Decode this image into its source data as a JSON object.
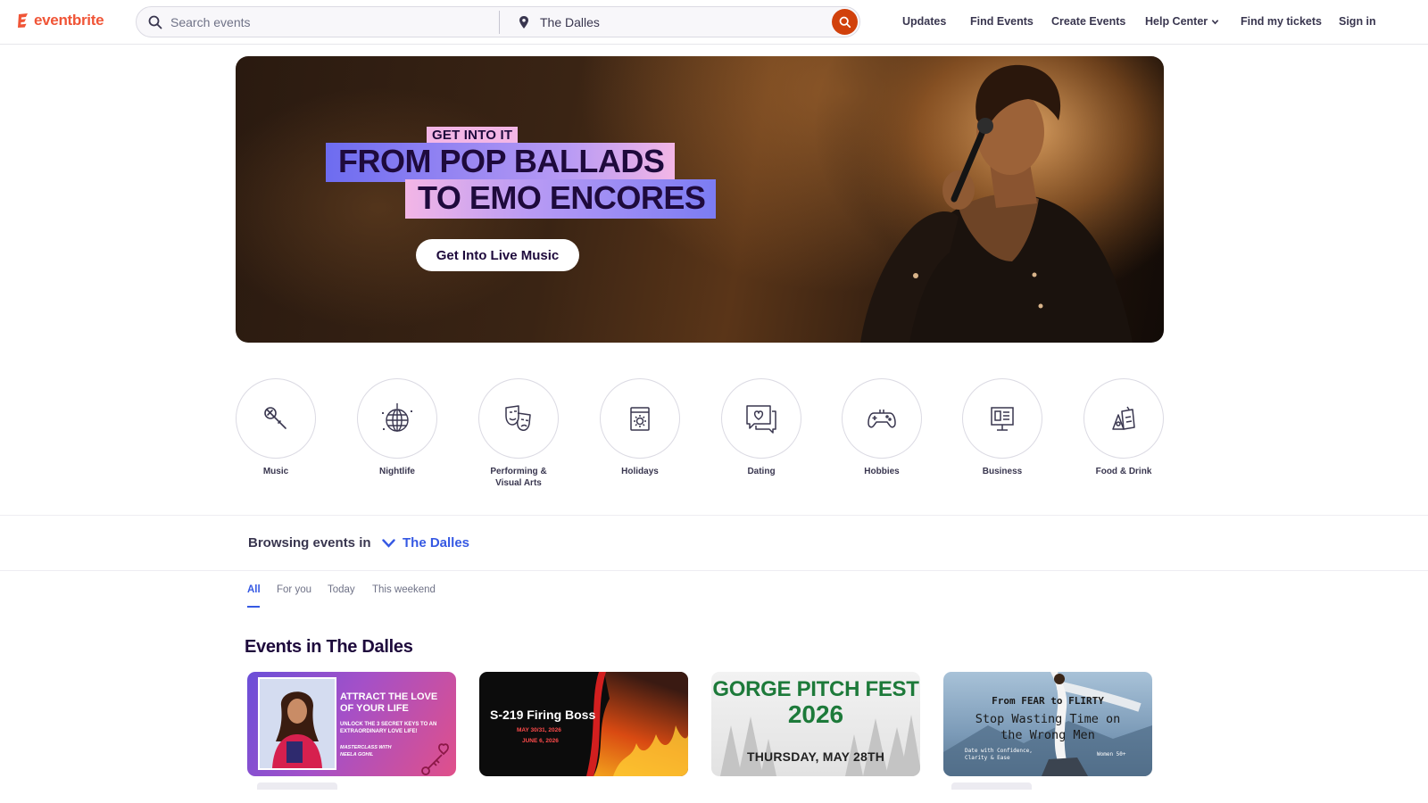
{
  "header": {
    "logo_text": "eventbrite",
    "search_placeholder": "Search events",
    "location_value": "The Dalles",
    "nav": [
      "Updates",
      "Find Events",
      "Create Events",
      "Help Center",
      "Find my tickets",
      "Sign in"
    ]
  },
  "hero": {
    "kicker": "GET INTO IT",
    "line1": "FROM POP BALLADS",
    "line2": "TO EMO ENCORES",
    "cta": "Get Into Live Music"
  },
  "categories": [
    {
      "label": "Music",
      "icon": "microphone-icon"
    },
    {
      "label": "Nightlife",
      "icon": "disco-ball-icon"
    },
    {
      "label": "Performing & Visual Arts",
      "icon": "theater-masks-icon"
    },
    {
      "label": "Holidays",
      "icon": "calendar-sun-icon"
    },
    {
      "label": "Dating",
      "icon": "chat-heart-icon"
    },
    {
      "label": "Hobbies",
      "icon": "game-controller-icon"
    },
    {
      "label": "Business",
      "icon": "presentation-board-icon"
    },
    {
      "label": "Food & Drink",
      "icon": "drinks-icon"
    }
  ],
  "browse": {
    "label": "Browsing events in",
    "location": "The Dalles"
  },
  "tabs": [
    {
      "label": "All",
      "active": true
    },
    {
      "label": "For you",
      "active": false
    },
    {
      "label": "Today",
      "active": false
    },
    {
      "label": "This weekend",
      "active": false
    }
  ],
  "events_section": {
    "title": "Events in The Dalles"
  },
  "events": [
    {
      "title": "ATTRACT THE LOVE OF YOUR LIFE",
      "subtitle": "UNLOCK THE 3 SECRET KEYS TO AN EXTRAORDINARY LOVE LIFE!",
      "footer": "MASTERCLASS WITH NEELA GOHIL"
    },
    {
      "title": "S-219 Firing Boss",
      "date1": "MAY 30/31, 2026",
      "date2": "JUNE 6, 2026"
    },
    {
      "title_line1": "GORGE PITCH FEST",
      "title_line2": "2026",
      "date": "THURSDAY, MAY 28TH"
    },
    {
      "line1": "From FEAR to FLIRTY",
      "line2": "Stop Wasting Time on",
      "line3": "the Wrong Men",
      "left_note": "Date with Confidence, Clarity & Ease",
      "right_note": "Women 50+"
    }
  ],
  "colors": {
    "brand": "#f05537",
    "accent_blue": "#3659e3",
    "text_dark": "#1e0a3c",
    "search_button": "#d1410c"
  }
}
